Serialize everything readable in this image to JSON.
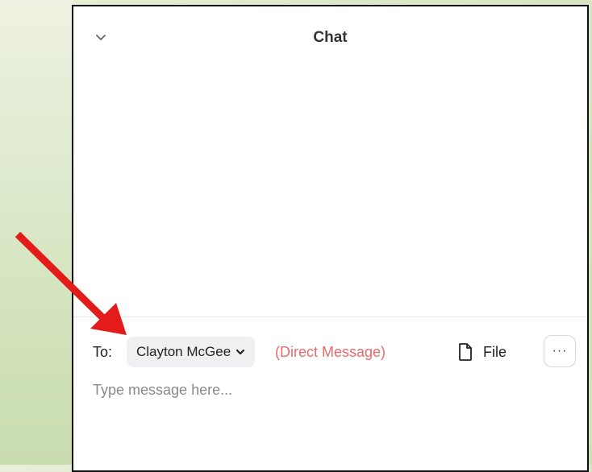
{
  "chat": {
    "title": "Chat",
    "collapse_icon": "chevron-down-icon"
  },
  "composer": {
    "to_label": "To:",
    "recipient": "Clayton McGee",
    "recipient_icon": "chevron-down-icon",
    "message_type": "(Direct Message)",
    "file_label": "File",
    "file_icon": "file-icon",
    "more_label": "···",
    "message_placeholder": "Type message here..."
  },
  "colors": {
    "direct_message": "#e86a6a",
    "annotation_arrow": "#e31b1b",
    "background": "#dbe8c8"
  }
}
